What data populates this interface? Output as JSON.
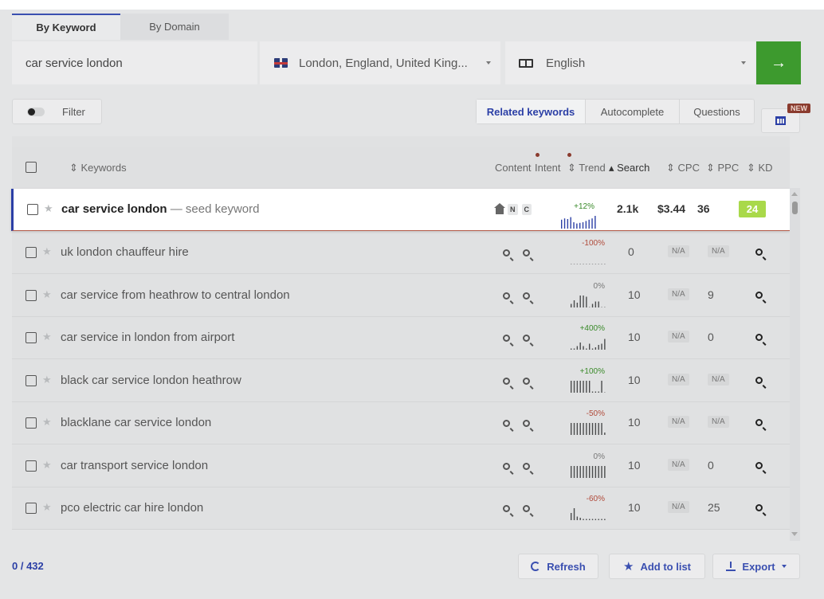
{
  "tabs": [
    {
      "label": "By Keyword",
      "active": true
    },
    {
      "label": "By Domain",
      "active": false
    }
  ],
  "search": {
    "keyword": "car service london",
    "location": "London, England, United King...",
    "language": "English"
  },
  "toolbar": {
    "filter_label": "Filter",
    "segments": [
      "Related keywords",
      "Autocomplete",
      "Questions"
    ],
    "active_segment": "Related keywords",
    "new_badge": "NEW"
  },
  "columns": {
    "keywords": "Keywords",
    "content": "Content",
    "intent": "Intent",
    "trend": "Trend",
    "search": "Search",
    "cpc": "CPC",
    "ppc": "PPC",
    "kd": "KD"
  },
  "seed_row": {
    "keyword": "car service london",
    "suffix": "— seed keyword",
    "intent_badges": [
      "N",
      "C"
    ],
    "trend": "+12%",
    "trend_bars": [
      0.7,
      0.8,
      0.75,
      0.9,
      0.5,
      0.4,
      0.45,
      0.5,
      0.6,
      0.7,
      0.8,
      1.0
    ],
    "search": "2.1k",
    "cpc": "$3.44",
    "ppc": "36",
    "kd": "24"
  },
  "rows": [
    {
      "keyword": "uk london chauffeur hire",
      "trend": "-100%",
      "trend_class": "neg",
      "trend_bars": [
        0,
        0,
        0,
        0,
        0,
        0,
        0,
        0,
        0,
        0,
        0,
        0
      ],
      "search": "0",
      "cpc": "N/A",
      "ppc": "N/A"
    },
    {
      "keyword": "car service from heathrow to central london",
      "trend": "0%",
      "trend_class": "neu",
      "trend_bars": [
        0.3,
        0.6,
        0.4,
        1.0,
        1.0,
        0.9,
        0,
        0.3,
        0.5,
        0.5,
        0,
        0
      ],
      "search": "10",
      "cpc": "N/A",
      "ppc": "9"
    },
    {
      "keyword": "car service in london from airport",
      "trend": "+400%",
      "trend_class": "pos",
      "trend_bars": [
        0.1,
        0.1,
        0.3,
        0.6,
        0.3,
        0.1,
        0.5,
        0.1,
        0.2,
        0.4,
        0.5,
        0.9
      ],
      "search": "10",
      "cpc": "N/A",
      "ppc": "0"
    },
    {
      "keyword": "black car service london heathrow",
      "trend": "+100%",
      "trend_class": "pos",
      "trend_bars": [
        1.0,
        1.0,
        1.0,
        1.0,
        1.0,
        1.0,
        1.0,
        0.1,
        0.1,
        0.1,
        1.0,
        0
      ],
      "search": "10",
      "cpc": "N/A",
      "ppc": "N/A"
    },
    {
      "keyword": "blacklane car service london",
      "trend": "-50%",
      "trend_class": "neg",
      "trend_bars": [
        1.0,
        1.0,
        1.0,
        1.0,
        1.0,
        1.0,
        1.0,
        1.0,
        1.0,
        1.0,
        1.0,
        0.2
      ],
      "search": "10",
      "cpc": "N/A",
      "ppc": "N/A"
    },
    {
      "keyword": "car transport service london",
      "trend": "0%",
      "trend_class": "neu",
      "trend_bars": [
        1.0,
        1.0,
        1.0,
        1.0,
        1.0,
        1.0,
        1.0,
        1.0,
        1.0,
        1.0,
        1.0,
        1.0
      ],
      "search": "10",
      "cpc": "N/A",
      "ppc": "0"
    },
    {
      "keyword": "pco electric car hire london",
      "trend": "-60%",
      "trend_class": "neg",
      "trend_bars": [
        0.6,
        1.0,
        0.3,
        0.2,
        0.1,
        0.1,
        0.1,
        0.1,
        0.1,
        0.1,
        0.1,
        0.1
      ],
      "search": "10",
      "cpc": "N/A",
      "ppc": "25"
    }
  ],
  "footer": {
    "count": "0 / 432",
    "refresh": "Refresh",
    "add_to_list": "Add to list",
    "export": "Export"
  },
  "colors": {
    "accent": "#2b3fa6",
    "go_button": "#3d9a2e",
    "kd_badge": "#a9d94a",
    "new_badge": "#8a3b2e"
  }
}
